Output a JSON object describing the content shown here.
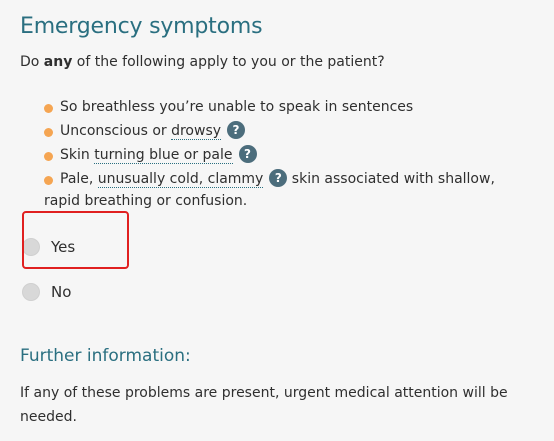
{
  "section_title": "Emergency symptoms",
  "question": {
    "before": "Do ",
    "emphasis": "any",
    "after": " of the following apply to you or the patient?"
  },
  "symptoms": [
    {
      "text": "So breathless you’re unable to speak in sentences"
    },
    {
      "before": "Unconscious or ",
      "term": "drowsy",
      "help": "?"
    },
    {
      "before": "Skin ",
      "term": "turning blue or pale",
      "help": "?"
    },
    {
      "before": "Pale, ",
      "term": "unusually cold, clammy",
      "help": "?",
      "after": " skin associated with shallow,",
      "after2": "rapid breathing or confusion."
    }
  ],
  "options": {
    "yes": "Yes",
    "no": "No"
  },
  "further": {
    "heading": "Further information:",
    "text": "If any of these problems are present, urgent medical attention will be needed."
  },
  "colors": {
    "heading": "#2a6f80",
    "bullet": "#f5a552",
    "help_badge": "#4c6d7c",
    "highlight": "#e02020"
  }
}
